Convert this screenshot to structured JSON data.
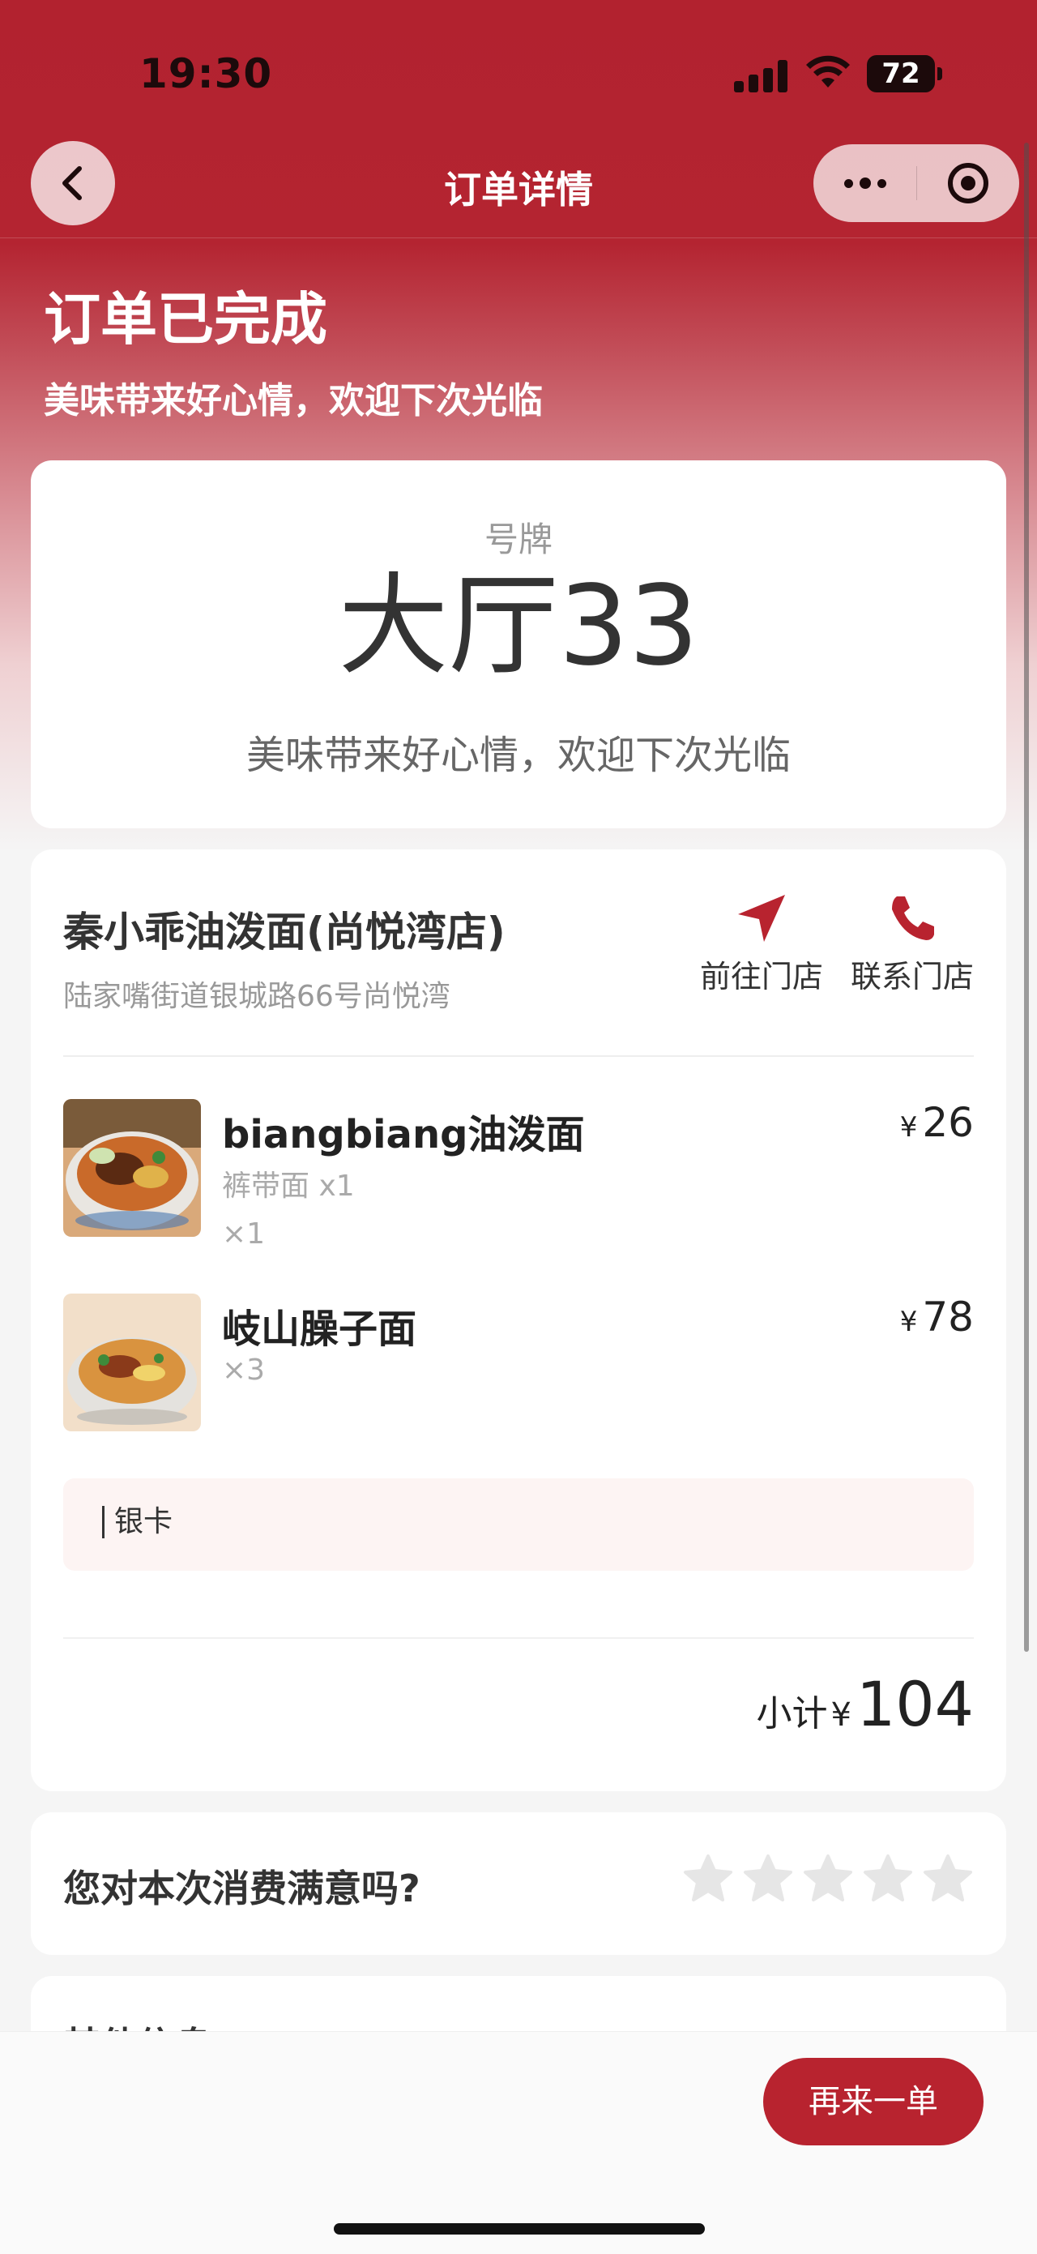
{
  "status_bar": {
    "time": "19:30",
    "battery": "72"
  },
  "nav": {
    "title": "订单详情"
  },
  "header": {
    "status_title": "订单已完成",
    "status_subtitle": "美味带来好心情，欢迎下次光临"
  },
  "ticket": {
    "label": "号牌",
    "number": "大厅33",
    "message": "美味带来好心情，欢迎下次光临"
  },
  "store": {
    "name": "秦小乖油泼面(尚悦湾店)",
    "address": "陆家嘴街道银城路66号尚悦湾",
    "actions": {
      "navigate_label": "前往门店",
      "call_label": "联系门店"
    }
  },
  "items": [
    {
      "name": "biangbiang油泼面",
      "spec": "裤带面 x1",
      "qty": "×1",
      "currency": "¥",
      "price": "26"
    },
    {
      "name": "岐山臊子面",
      "qty": "×3",
      "currency": "¥",
      "price": "78"
    }
  ],
  "remark": {
    "text": "银卡"
  },
  "subtotal": {
    "label": "小计",
    "currency": "¥",
    "amount": "104"
  },
  "rating": {
    "question": "您对本次消费满意吗?",
    "stars": 0,
    "max_stars": 5
  },
  "other": {
    "title": "其他信息"
  },
  "bottom": {
    "reorder_label": "再来一单"
  },
  "colors": {
    "brand": "#b8232f",
    "header_red": "#b2222f"
  }
}
